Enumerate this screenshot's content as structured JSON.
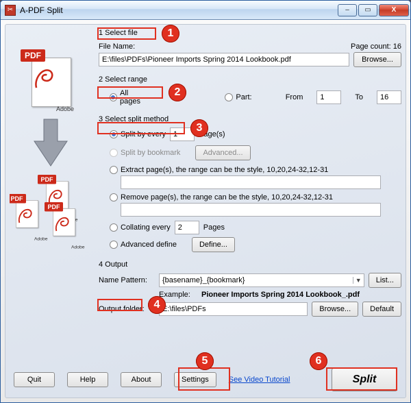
{
  "window": {
    "title": "A-PDF Split"
  },
  "winbtns": {
    "min": "–",
    "max": "▭",
    "close": "X"
  },
  "sidebar": {
    "pdf_badge": "PDF",
    "adobe": "Adobe"
  },
  "step1": {
    "heading": "1 Select file",
    "file_name_label": "File Name:",
    "file_name_value": "E:\\files\\PDFs\\Pioneer Imports Spring 2014 Lookbook.pdf",
    "page_count": "Page count: 16",
    "browse": "Browse..."
  },
  "step2": {
    "heading": "2 Select range",
    "all_pages": "All pages",
    "part": "Part:",
    "from_label": "From",
    "from_value": "1",
    "to_label": "To",
    "to_value": "16"
  },
  "step3": {
    "heading": "3 Select split method",
    "split_every": "Split by every",
    "split_every_value": "1",
    "pages_suffix": "Page(s)",
    "split_bookmark": "Split by bookmark",
    "advanced_btn": "Advanced...",
    "extract": "Extract page(s), the range can be the style, 10,20,24-32,12-31",
    "extract_value": "",
    "remove": "Remove page(s), the range can be the style, 10,20,24-32,12-31",
    "remove_value": "",
    "collating": "Collating every",
    "collating_value": "2",
    "collating_suffix": "Pages",
    "advanced_define": "Advanced define",
    "define_btn": "Define..."
  },
  "step4": {
    "heading": "4 Output",
    "name_pattern_label": "Name Pattern:",
    "name_pattern_value": "{basename}_{bookmark}",
    "list_btn": "List...",
    "example_label": "Example:",
    "example_value": "Pioneer Imports Spring 2014 Lookbook_.pdf",
    "output_folder_label": "Output folder:",
    "output_folder_value": "E:\\files\\PDFs",
    "browse": "Browse...",
    "default": "Default"
  },
  "footer": {
    "quit": "Quit",
    "help": "Help",
    "about": "About",
    "settings": "Settings",
    "tutorial": "See Video Tutorial",
    "split": "Split"
  },
  "callouts": {
    "c1": "1",
    "c2": "2",
    "c3": "3",
    "c4": "4",
    "c5": "5",
    "c6": "6"
  }
}
